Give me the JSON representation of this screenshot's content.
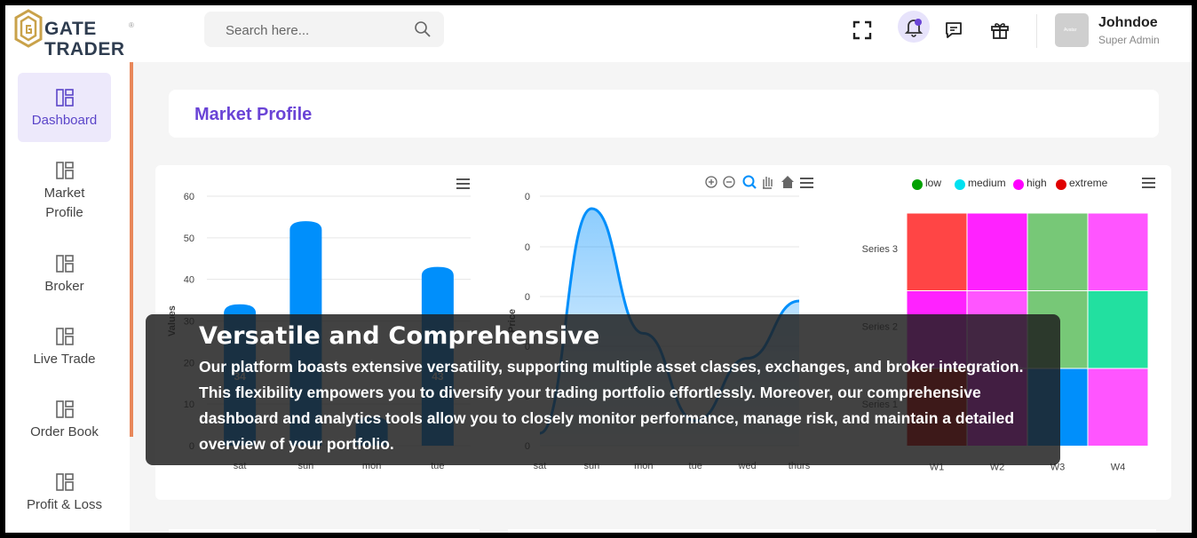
{
  "header": {
    "logo": {
      "line1": "GATE",
      "line2": "TRADER",
      "reg": "®"
    },
    "search": {
      "placeholder": "Search here..."
    },
    "user": {
      "name": "Johndoe",
      "role": "Super Admin",
      "avatar_text": "Avatar"
    },
    "icons": [
      "fullscreen-icon",
      "bell-icon",
      "chat-icon",
      "gift-icon"
    ]
  },
  "sidebar": {
    "items": [
      {
        "label": "Dashboard",
        "active": true
      },
      {
        "label": "Market\nProfile"
      },
      {
        "label": "Broker"
      },
      {
        "label": "Live Trade"
      },
      {
        "label": "Order Book"
      },
      {
        "label": "Profit & Loss"
      }
    ]
  },
  "page": {
    "title": "Market Profile"
  },
  "colors": {
    "accent": "#6a44d6",
    "bar": "#008ffb",
    "sidebar_accent": "#e8875a"
  },
  "chart_data": [
    {
      "type": "bar",
      "categories": [
        "sat",
        "sun",
        "mon",
        "tue"
      ],
      "values": [
        34,
        54,
        7,
        43
      ],
      "ylabel": "Values",
      "ylim": [
        0,
        60
      ],
      "yticks": [
        0,
        10,
        20,
        30,
        40,
        50,
        60
      ],
      "data_labels": [
        "34",
        "",
        "",
        "43"
      ],
      "grid": true
    },
    {
      "type": "area",
      "categories": [
        "sat",
        "sun",
        "mon",
        "tue",
        "wed",
        "thurs"
      ],
      "values": [
        5,
        95,
        45,
        10,
        35,
        58
      ],
      "ylabel": "Price",
      "yticks": [
        "0",
        "0",
        "0",
        "0",
        "0",
        "0",
        "0"
      ],
      "grid": true,
      "toolbar": [
        "zoom-in-icon",
        "zoom-out-icon",
        "zoom-select-icon",
        "pan-icon",
        "home-icon",
        "menu-icon"
      ]
    },
    {
      "type": "heatmap",
      "legend": [
        {
          "name": "low",
          "color": "#00a100"
        },
        {
          "name": "medium",
          "color": "#00e1f0"
        },
        {
          "name": "high",
          "color": "#ff00ff"
        },
        {
          "name": "extreme",
          "color": "#e00000"
        }
      ],
      "x": [
        "W1",
        "W2",
        "W3",
        "W4"
      ],
      "y": [
        "Series 3",
        "Series 2",
        "Series 1"
      ],
      "cells": [
        [
          "#ff4545",
          "#ff22ff",
          "#77c877",
          "#ff55ff"
        ],
        [
          "#ff22ff",
          "#ff55ff",
          "#77c877",
          "#22e0a0"
        ],
        [
          "#e00000",
          "#ff22ff",
          "#008ffb",
          "#ff55ff"
        ]
      ]
    }
  ],
  "overlay": {
    "title": "Versatile and Comprehensive",
    "body": "Our platform boasts extensive versatility, supporting multiple asset classes, exchanges, and broker integration. This flexibility empowers you to diversify your trading portfolio effortlessly. Moreover, our comprehensive dashboard and analytics tools allow you to closely monitor performance, manage risk, and maintain a detailed overview of your portfolio."
  }
}
